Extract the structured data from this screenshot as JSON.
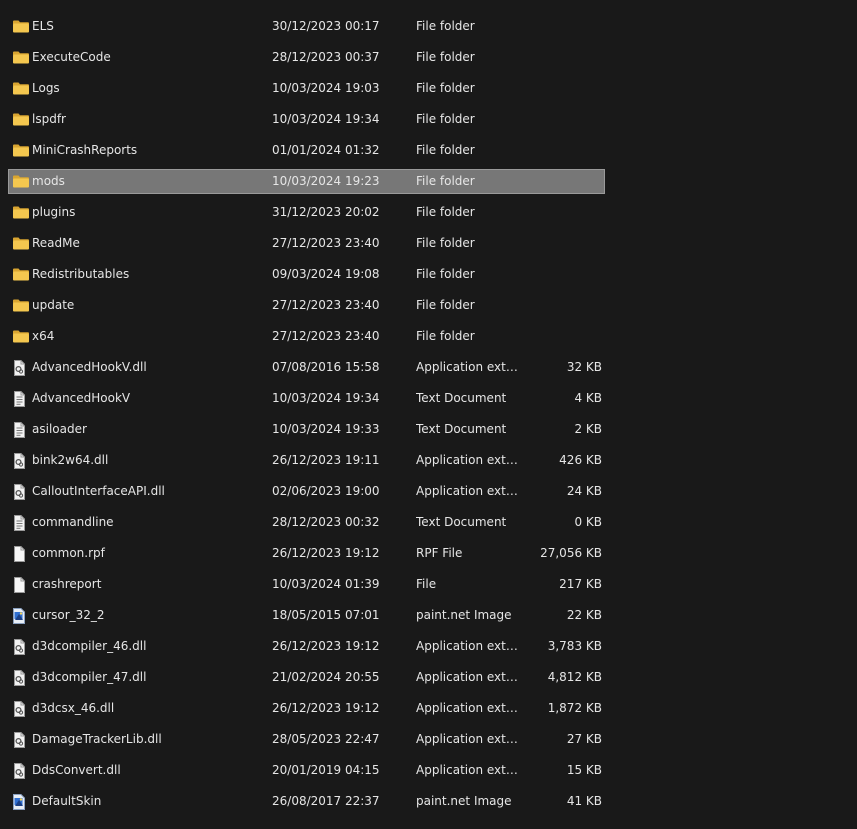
{
  "colors": {
    "background": "#191919",
    "text": "#e6e6e6",
    "selected_row_bg": "#777777",
    "folder_icon": "#f4c74f"
  },
  "files": [
    {
      "name": "ELS",
      "date": "30/12/2023 00:17",
      "type": "File folder",
      "size": "",
      "icon": "folder-icon"
    },
    {
      "name": "ExecuteCode",
      "date": "28/12/2023 00:37",
      "type": "File folder",
      "size": "",
      "icon": "folder-icon"
    },
    {
      "name": "Logs",
      "date": "10/03/2024 19:03",
      "type": "File folder",
      "size": "",
      "icon": "folder-icon"
    },
    {
      "name": "lspdfr",
      "date": "10/03/2024 19:34",
      "type": "File folder",
      "size": "",
      "icon": "folder-icon"
    },
    {
      "name": "MiniCrashReports",
      "date": "01/01/2024 01:32",
      "type": "File folder",
      "size": "",
      "icon": "folder-icon"
    },
    {
      "name": "mods",
      "date": "10/03/2024 19:23",
      "type": "File folder",
      "size": "",
      "icon": "folder-icon",
      "selected": true
    },
    {
      "name": "plugins",
      "date": "31/12/2023 20:02",
      "type": "File folder",
      "size": "",
      "icon": "folder-icon"
    },
    {
      "name": "ReadMe",
      "date": "27/12/2023 23:40",
      "type": "File folder",
      "size": "",
      "icon": "folder-icon"
    },
    {
      "name": "Redistributables",
      "date": "09/03/2024 19:08",
      "type": "File folder",
      "size": "",
      "icon": "folder-icon"
    },
    {
      "name": "update",
      "date": "27/12/2023 23:40",
      "type": "File folder",
      "size": "",
      "icon": "folder-icon"
    },
    {
      "name": "x64",
      "date": "27/12/2023 23:40",
      "type": "File folder",
      "size": "",
      "icon": "folder-icon"
    },
    {
      "name": "AdvancedHookV.dll",
      "date": "07/08/2016 15:58",
      "type": "Application exten...",
      "size": "32 KB",
      "icon": "dll-icon"
    },
    {
      "name": "AdvancedHookV",
      "date": "10/03/2024 19:34",
      "type": "Text Document",
      "size": "4 KB",
      "icon": "text-document-icon"
    },
    {
      "name": "asiloader",
      "date": "10/03/2024 19:33",
      "type": "Text Document",
      "size": "2 KB",
      "icon": "text-document-icon"
    },
    {
      "name": "bink2w64.dll",
      "date": "26/12/2023 19:11",
      "type": "Application exten...",
      "size": "426 KB",
      "icon": "dll-icon"
    },
    {
      "name": "CalloutInterfaceAPI.dll",
      "date": "02/06/2023 19:00",
      "type": "Application exten...",
      "size": "24 KB",
      "icon": "dll-icon"
    },
    {
      "name": "commandline",
      "date": "28/12/2023 00:32",
      "type": "Text Document",
      "size": "0 KB",
      "icon": "text-document-icon"
    },
    {
      "name": "common.rpf",
      "date": "26/12/2023 19:12",
      "type": "RPF File",
      "size": "27,056 KB",
      "icon": "file-icon"
    },
    {
      "name": "crashreport",
      "date": "10/03/2024 01:39",
      "type": "File",
      "size": "217 KB",
      "icon": "file-icon"
    },
    {
      "name": "cursor_32_2",
      "date": "18/05/2015 07:01",
      "type": "paint.net Image",
      "size": "22 KB",
      "icon": "paintnet-image-icon"
    },
    {
      "name": "d3dcompiler_46.dll",
      "date": "26/12/2023 19:12",
      "type": "Application exten...",
      "size": "3,783 KB",
      "icon": "dll-icon"
    },
    {
      "name": "d3dcompiler_47.dll",
      "date": "21/02/2024 20:55",
      "type": "Application exten...",
      "size": "4,812 KB",
      "icon": "dll-icon"
    },
    {
      "name": "d3dcsx_46.dll",
      "date": "26/12/2023 19:12",
      "type": "Application exten...",
      "size": "1,872 KB",
      "icon": "dll-icon"
    },
    {
      "name": "DamageTrackerLib.dll",
      "date": "28/05/2023 22:47",
      "type": "Application exten...",
      "size": "27 KB",
      "icon": "dll-icon"
    },
    {
      "name": "DdsConvert.dll",
      "date": "20/01/2019 04:15",
      "type": "Application exten...",
      "size": "15 KB",
      "icon": "dll-icon"
    },
    {
      "name": "DefaultSkin",
      "date": "26/08/2017 22:37",
      "type": "paint.net Image",
      "size": "41 KB",
      "icon": "paintnet-image-icon"
    }
  ]
}
